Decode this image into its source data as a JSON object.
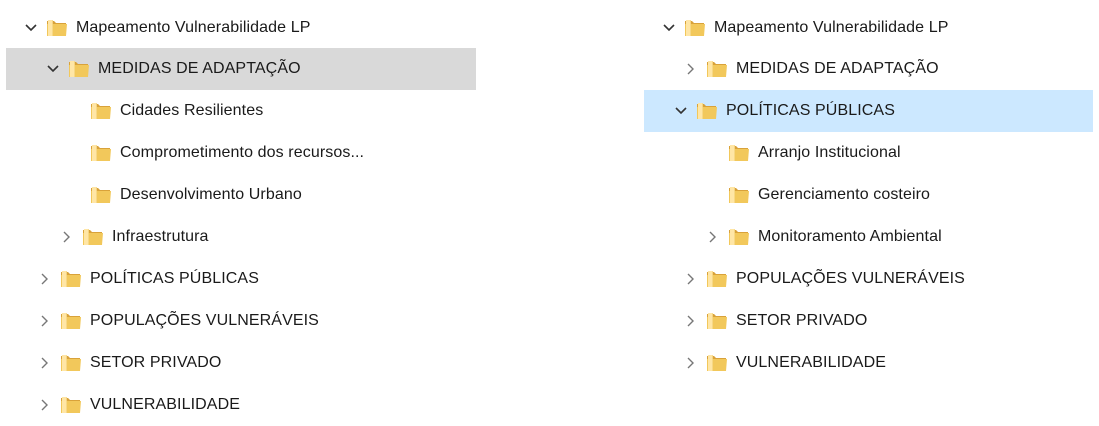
{
  "left_tree": {
    "root": {
      "label": "Mapeamento Vulnerabilidade LP",
      "expanded": true
    },
    "items": [
      {
        "label": "MEDIDAS DE ADAPTAÇÃO",
        "expanded": true,
        "selected": true
      },
      {
        "label": "Cidades Resilientes"
      },
      {
        "label": "Comprometimento dos recursos..."
      },
      {
        "label": "Desenvolvimento Urbano"
      },
      {
        "label": "Infraestrutura",
        "expanded": false
      },
      {
        "label": "POLÍTICAS PÚBLICAS",
        "expanded": false
      },
      {
        "label": "POPULAÇÕES VULNERÁVEIS",
        "expanded": false
      },
      {
        "label": "SETOR PRIVADO",
        "expanded": false
      },
      {
        "label": "VULNERABILIDADE",
        "expanded": false
      }
    ]
  },
  "right_tree": {
    "root": {
      "label": "Mapeamento Vulnerabilidade LP",
      "expanded": true
    },
    "items": [
      {
        "label": "MEDIDAS DE ADAPTAÇÃO",
        "expanded": false
      },
      {
        "label": "POLÍTICAS PÚBLICAS",
        "expanded": true,
        "selected": true
      },
      {
        "label": "Arranjo Institucional"
      },
      {
        "label": "Gerenciamento costeiro"
      },
      {
        "label": "Monitoramento Ambiental",
        "expanded": false
      },
      {
        "label": "POPULAÇÕES VULNERÁVEIS",
        "expanded": false
      },
      {
        "label": "SETOR PRIVADO",
        "expanded": false
      },
      {
        "label": "VULNERABILIDADE",
        "expanded": false
      }
    ]
  },
  "icons": {
    "folder": "folder-icon",
    "expand": "chevron-right-icon",
    "collapse": "chevron-down-icon"
  },
  "colors": {
    "selected_gray": "#d9d9d9",
    "selected_blue": "#cce8ff",
    "folder": "#e8b84a"
  }
}
